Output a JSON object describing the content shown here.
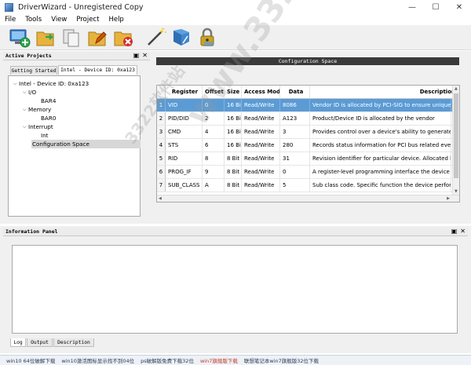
{
  "window": {
    "title": "DriverWizard - Unregistered Copy",
    "min_glyph": "—",
    "max_glyph": "☐",
    "close_glyph": "✕"
  },
  "menu": [
    "File",
    "Tools",
    "View",
    "Project",
    "Help"
  ],
  "toolbar": {
    "icons": [
      "new-project-icon",
      "open-device-icon",
      "copy-icon",
      "edit-icon",
      "delete-icon",
      "wand-icon",
      "generate-code-icon",
      "lock-icon"
    ]
  },
  "active_projects": {
    "header": "Active Projects",
    "controls": [
      "▣",
      "✕"
    ],
    "tabs": [
      "Getting Started",
      "Intel - Device ID: 0xa123"
    ],
    "tree": [
      {
        "label": "Intel - Device ID: 0xa123",
        "expander": "⌵",
        "level": 0
      },
      {
        "label": "I/O",
        "expander": "⌵",
        "level": 1
      },
      {
        "label": "BAR4",
        "expander": "",
        "level": 2
      },
      {
        "label": "Memory",
        "expander": "⌵",
        "level": 1
      },
      {
        "label": "BAR0",
        "expander": "",
        "level": 2
      },
      {
        "label": "Interrupt",
        "expander": "⌵",
        "level": 1
      },
      {
        "label": "Int",
        "expander": "",
        "level": 2
      },
      {
        "label": "Configuration Space",
        "expander": "",
        "level": 1
      }
    ]
  },
  "config_space": {
    "header": "Configuration Space",
    "columns": [
      "Register",
      "Offset",
      "Size",
      "Access Mode",
      "Data",
      "Description"
    ],
    "rows": [
      {
        "num": "1",
        "register": "VID",
        "offset": "0",
        "size": "16 Bit",
        "access": "Read/Write",
        "data": "8086",
        "description": "Vendor ID is allocated by PCI-SIG to ensure uniquene"
      },
      {
        "num": "2",
        "register": "PID/DID",
        "offset": "2",
        "size": "16 Bit",
        "access": "Read/Write",
        "data": "A123",
        "description": "Product/Device ID is allocated by the vendor"
      },
      {
        "num": "3",
        "register": "CMD",
        "offset": "4",
        "size": "16 Bit",
        "access": "Read/Write",
        "data": "3",
        "description": "Provides control over a device's ability to generate an"
      },
      {
        "num": "4",
        "register": "STS",
        "offset": "6",
        "size": "16 Bit",
        "access": "Read/Write",
        "data": "280",
        "description": "Records status information for PCI bus related events"
      },
      {
        "num": "5",
        "register": "RID",
        "offset": "8",
        "size": "8 Bit",
        "access": "Read/Write",
        "data": "31",
        "description": "Revision identifier for particular device. Allocated by"
      },
      {
        "num": "6",
        "register": "PROG_IF",
        "offset": "9",
        "size": "8 Bit",
        "access": "Read/Write",
        "data": "0",
        "description": "A register-level programming interface the device has"
      },
      {
        "num": "7",
        "register": "SUB_CLASS",
        "offset": "A",
        "size": "8 Bit",
        "access": "Read/Write",
        "data": "5",
        "description": "Sub class code. Specific function the device performs"
      }
    ]
  },
  "information_panel": {
    "header": "Information Panel",
    "controls": [
      "▣",
      "✕"
    ],
    "tabs": [
      "Log",
      "Output",
      "Description"
    ]
  },
  "taskbar": [
    "win10 64位破解下载",
    "win10激活图标显示找不到04位",
    "ps破解版免费下载32位",
    "win7旗舰版下载",
    "联想笔记本win7旗舰版32位下载"
  ],
  "watermark": {
    "big": "www.3322.cc",
    "small": "3322软件站"
  },
  "colors": {
    "selection": "#5b9bd5",
    "config_header": "#3a3a3a",
    "panel": "#f0f0f0"
  }
}
